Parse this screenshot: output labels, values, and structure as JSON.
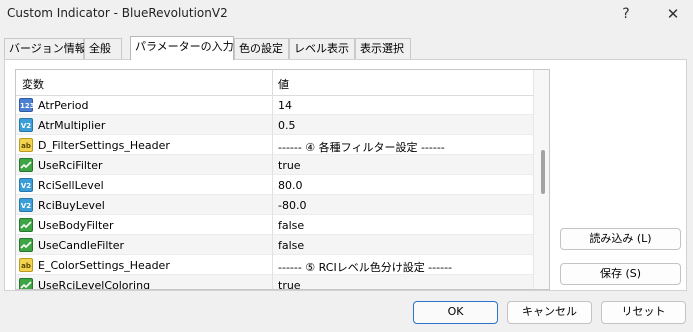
{
  "window": {
    "title": "Custom Indicator - BlueRevolutionV2",
    "help_glyph": "?",
    "close_glyph": "✕"
  },
  "tabs": [
    {
      "label": "バージョン情報"
    },
    {
      "label": "全般"
    },
    {
      "label": "パラメーターの入力",
      "active": true
    },
    {
      "label": "色の設定"
    },
    {
      "label": "レベル表示"
    },
    {
      "label": "表示選択"
    }
  ],
  "grid": {
    "col_variable": "変数",
    "col_value": "値",
    "rows": [
      {
        "icon": "int-icon",
        "icon_text": "123",
        "name": "AtrPeriod",
        "value": "14"
      },
      {
        "icon": "double-icon",
        "icon_text": "V2",
        "name": "AtrMultiplier",
        "value": "0.5"
      },
      {
        "icon": "string-icon",
        "icon_text": "ab",
        "name": "D_FilterSettings_Header",
        "value": "------ ④ 各種フィルター設定 ------"
      },
      {
        "icon": "bool-icon",
        "icon_text": "",
        "name": "UseRciFilter",
        "value": "true"
      },
      {
        "icon": "double-icon",
        "icon_text": "V2",
        "name": "RciSellLevel",
        "value": "80.0"
      },
      {
        "icon": "double-icon",
        "icon_text": "V2",
        "name": "RciBuyLevel",
        "value": "-80.0"
      },
      {
        "icon": "bool-icon",
        "icon_text": "",
        "name": "UseBodyFilter",
        "value": "false"
      },
      {
        "icon": "bool-icon",
        "icon_text": "",
        "name": "UseCandleFilter",
        "value": "false"
      },
      {
        "icon": "string-icon",
        "icon_text": "ab",
        "name": "E_ColorSettings_Header",
        "value": "------ ⑤ RCIレベル色分け設定 ------"
      },
      {
        "icon": "bool-icon",
        "icon_text": "",
        "name": "UseRciLevelColoring",
        "value": "true"
      }
    ]
  },
  "buttons": {
    "load": "読み込み (L)",
    "save": "保存 (S)",
    "ok": "OK",
    "cancel": "キャンセル",
    "reset": "リセット"
  }
}
